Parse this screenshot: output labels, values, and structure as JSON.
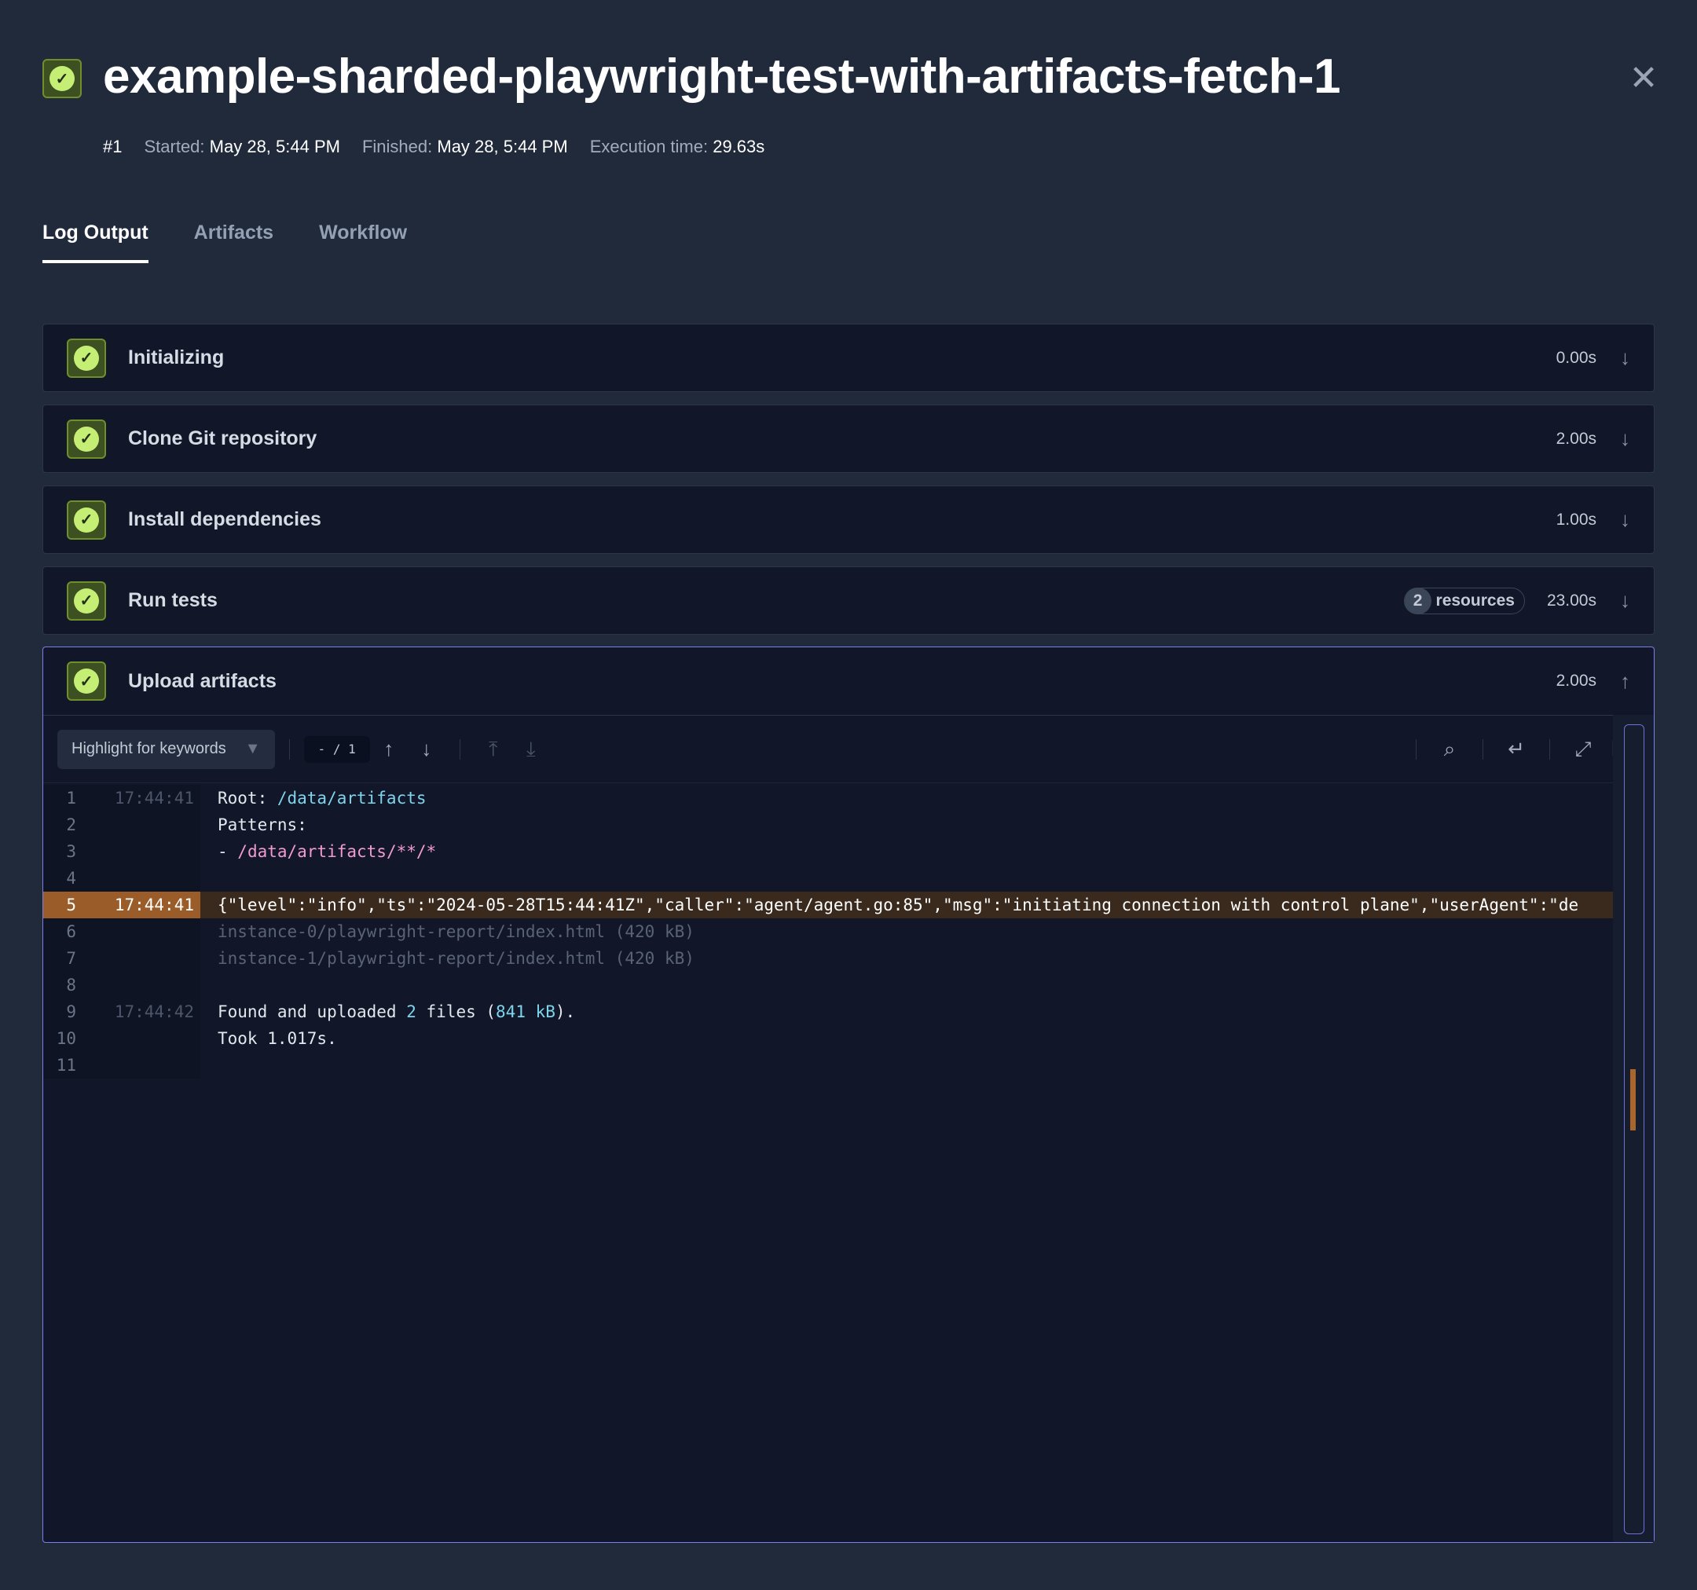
{
  "header": {
    "title": "example-sharded-playwright-test-with-artifacts-fetch-1",
    "status": "success",
    "run": "#1",
    "started_label": "Started:",
    "started": "May 28, 5:44 PM",
    "finished_label": "Finished:",
    "finished": "May 28, 5:44 PM",
    "exec_label": "Execution time:",
    "exec": "29.63s"
  },
  "tabs": [
    {
      "label": "Log Output",
      "active": true
    },
    {
      "label": "Artifacts"
    },
    {
      "label": "Workflow"
    }
  ],
  "steps": [
    {
      "name": "Initializing",
      "duration": "0.00s"
    },
    {
      "name": "Clone Git repository",
      "duration": "2.00s"
    },
    {
      "name": "Install dependencies",
      "duration": "1.00s"
    },
    {
      "name": "Run tests",
      "duration": "23.00s",
      "resources_count": "2",
      "resources_label": "resources"
    },
    {
      "name": "Upload artifacts",
      "duration": "2.00s",
      "expanded": true
    }
  ],
  "toolbar": {
    "highlight_placeholder": "Highlight for keywords",
    "pager": "- / 1"
  },
  "log": [
    {
      "n": "1",
      "ts": "17:44:41",
      "parts": [
        [
          "Root: ",
          ""
        ],
        [
          "/data/artifacts",
          "cy"
        ]
      ]
    },
    {
      "n": "2",
      "ts": "",
      "parts": [
        [
          "Patterns:",
          ""
        ]
      ]
    },
    {
      "n": "3",
      "ts": "",
      "parts": [
        [
          "- ",
          ""
        ],
        [
          "/data/artifacts/**/*",
          "pk"
        ]
      ]
    },
    {
      "n": "4",
      "ts": "",
      "parts": []
    },
    {
      "n": "5",
      "ts": "17:44:41",
      "hi": true,
      "parts": [
        [
          "{\"level\":\"info\",\"ts\":\"2024-05-28T15:44:41Z\",\"caller\":\"agent/agent.go:85\",\"msg\":\"initiating connection with control plane\",\"userAgent\":\"de",
          ""
        ]
      ]
    },
    {
      "n": "6",
      "ts": "",
      "parts": [
        [
          "instance-0/playwright-report/index.html (420 kB)",
          "dim"
        ]
      ]
    },
    {
      "n": "7",
      "ts": "",
      "parts": [
        [
          "instance-1/playwright-report/index.html (420 kB)",
          "dim"
        ]
      ]
    },
    {
      "n": "8",
      "ts": "",
      "parts": []
    },
    {
      "n": "9",
      "ts": "17:44:42",
      "parts": [
        [
          "Found and uploaded ",
          ""
        ],
        [
          "2",
          "cy"
        ],
        [
          " files (",
          ""
        ],
        [
          "841 kB",
          "cy"
        ],
        [
          ").",
          ""
        ]
      ]
    },
    {
      "n": "10",
      "ts": "",
      "parts": [
        [
          "Took 1.017s.",
          ""
        ]
      ]
    },
    {
      "n": "11",
      "ts": "",
      "parts": []
    }
  ],
  "colors": {
    "success": "#c5ef74",
    "accent": "#7a7ff0",
    "highlight": "#9a5c28"
  }
}
